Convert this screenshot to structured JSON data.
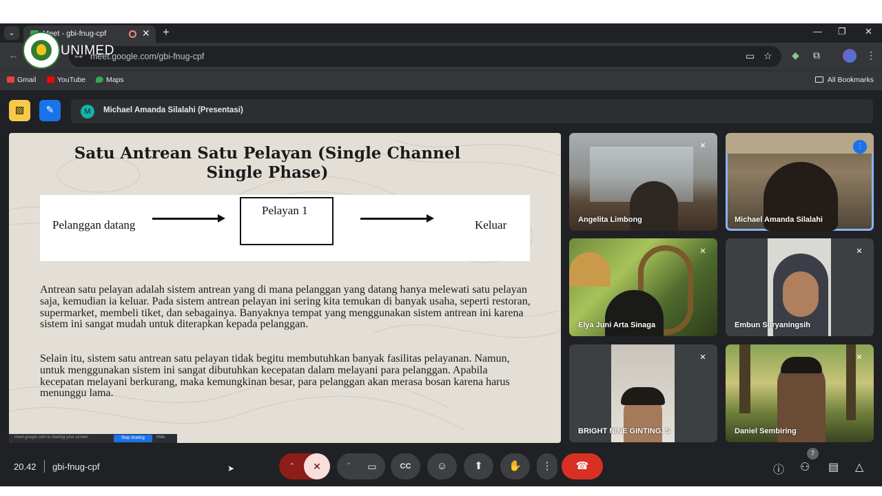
{
  "browser": {
    "tab_title": "Meet - gbi-fnug-cpf",
    "tab_close": "✕",
    "new_tab": "+",
    "tab_menu": "⌄",
    "window_controls": [
      "—",
      "❐",
      "✕"
    ],
    "url": "meet.google.com/gbi-fnug-cpf",
    "bookmarks": [
      {
        "label": "Gmail",
        "color": "#ea4335"
      },
      {
        "label": "YouTube",
        "color": "#ff0000"
      },
      {
        "label": "Maps",
        "color": "#34a853"
      }
    ],
    "all_bookmarks": "All Bookmarks",
    "icons": [
      "camera-icon",
      "star-icon",
      "extension-icon",
      "puzzle-icon",
      "profile-avatar",
      "menu-icon"
    ]
  },
  "watermark": {
    "text": "UNIMED",
    "emblem_text": "UNIVERSITAS NEGERI MEDAN"
  },
  "meeting": {
    "presenter_initial": "M",
    "presenter_label": "Michael Amanda Silalahi (Presentasi)",
    "time": "20.42",
    "code": "gbi-fnug-cpf",
    "participants_count": "7",
    "accent_color": "#8ab4f8",
    "hangup_color": "#d93025"
  },
  "slide": {
    "title_line1": "Satu Antrean Satu Pelayan  (Single Channel",
    "title_line2": "Single Phase)",
    "diagram": {
      "left": "Pelanggan datang",
      "box": "Pelayan 1",
      "right": "Keluar"
    },
    "paragraph1": "Antrean satu pelayan adalah sistem antrean yang di mana pelanggan yang datang hanya melewati satu pelayan saja, kemudian ia keluar. Pada sistem antrean pelayan ini sering kita temukan di banyak usaha, seperti restoran, supermarket, membeli tiket, dan sebagainya. Banyaknya tempat yang menggunakan sistem antrean ini karena sistem ini sangat mudah untuk diterapkan kepada pelanggan.",
    "paragraph2": "Selain itu, sistem satu antrean satu pelayan tidak begitu membutuhkan banyak fasilitas pelayanan. Namun, untuk menggunakan sistem ini sangat dibutuhkan kecepatan dalam melayani para pelanggan. Apabila kecepatan melayani berkurang, maka kemungkinan besar, para pelanggan akan merasa bosan karena harus menunggu lama.",
    "share_text": "meet.google.com is sharing your screen.",
    "share_stop": "Stop sharing",
    "share_hide": "Hide"
  },
  "participants": [
    {
      "name": "Angelita Limbong",
      "muted": true
    },
    {
      "name": "Michael Amanda Silalahi",
      "muted": false,
      "speaking": true
    },
    {
      "name": "Elya Juni Arta Sinaga",
      "muted": true
    },
    {
      "name": "Embun Suryaningsih",
      "muted": true
    },
    {
      "name": "BRIGHT NINE GINTING. S",
      "muted": true
    },
    {
      "name": "Daniel Sembiring",
      "muted": true
    }
  ]
}
